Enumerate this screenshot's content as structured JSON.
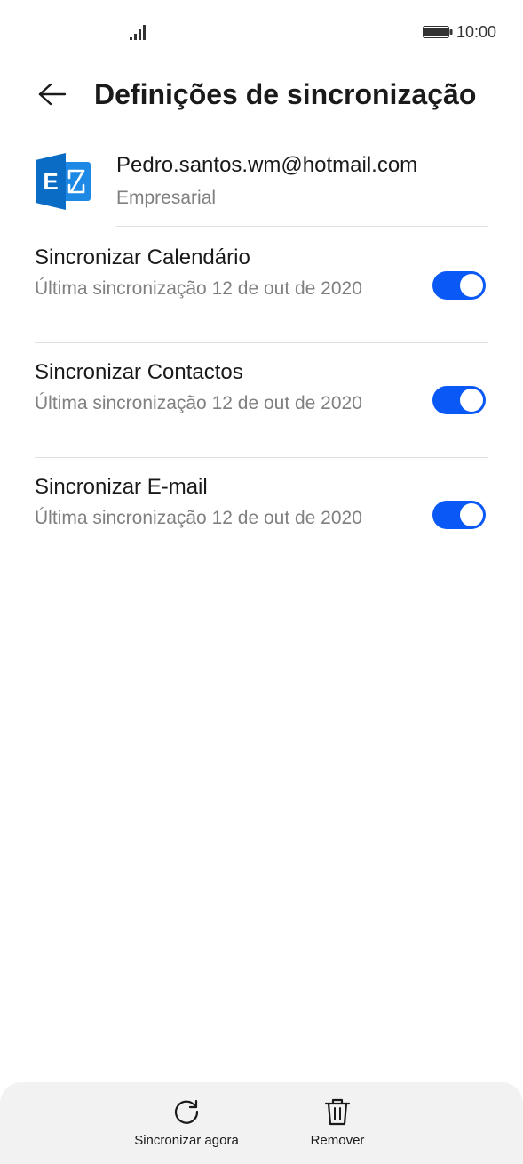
{
  "status_bar": {
    "time": "10:00",
    "signal_icon": "signal-icon",
    "battery_icon": "battery-icon"
  },
  "header": {
    "title": "Definições de sincronização",
    "back_icon": "arrow-left-icon"
  },
  "account": {
    "email": "Pedro.santos.wm@hotmail.com",
    "type": "Empresarial",
    "logo_icon": "exchange-logo-icon",
    "logo_letter": "E"
  },
  "sync_items": [
    {
      "title": "Sincronizar Calendário",
      "last_sync": "Última sincronização 12 de out de 2020",
      "enabled": true
    },
    {
      "title": "Sincronizar Contactos",
      "last_sync": "Última sincronização 12 de out de 2020",
      "enabled": true
    },
    {
      "title": "Sincronizar E-mail",
      "last_sync": "Última sincronização 12 de out de 2020",
      "enabled": true
    }
  ],
  "bottom_bar": {
    "sync_now_label": "Sincronizar agora",
    "sync_now_icon": "refresh-icon",
    "remove_label": "Remover",
    "remove_icon": "trash-icon"
  },
  "colors": {
    "accent": "#0a59f7",
    "exchange_blue": "#0b6cc6",
    "secondary_text": "#808080"
  }
}
